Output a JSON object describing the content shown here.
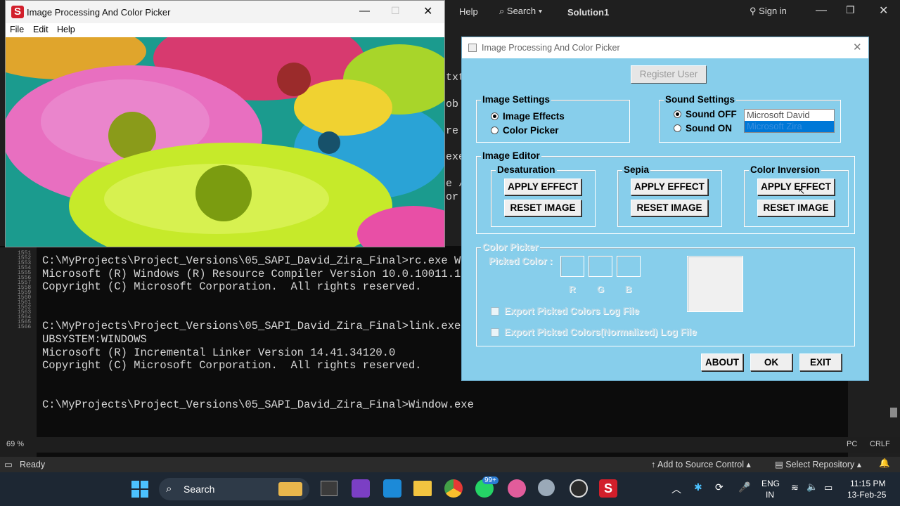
{
  "vs": {
    "menu_help": "Help",
    "search_label": "Search",
    "solution_name": "Solution1",
    "sign_in": "Sign in",
    "side_text": [
      "txt",
      "ob",
      "re",
      "exe",
      "e /",
      "or"
    ],
    "gutter_lines": [
      "1551",
      "1552",
      "1553",
      "1554",
      "1555",
      "1556",
      "1557",
      "1558",
      "1559",
      "1560",
      "1561",
      "1562",
      "1563",
      "1564",
      "1565",
      "1566"
    ],
    "console_lines": [
      "C:\\MyProjects\\Project_Versions\\05_SAPI_David_Zira_Final>rc.exe W",
      "Microsoft (R) Windows (R) Resource Compiler Version 10.0.10011.1",
      "Copyright (C) Microsoft Corporation.  All rights reserved.",
      "",
      "",
      "C:\\MyProjects\\Project_Versions\\05_SAPI_David_Zira_Final>link.exe",
      "UBSYSTEM:WINDOWS",
      "Microsoft (R) Incremental Linker Version 14.41.34120.0",
      "Copyright (C) Microsoft Corporation.  All rights reserved.",
      "",
      "",
      "C:\\MyProjects\\Project_Versions\\05_SAPI_David_Zira_Final>Window.exe"
    ],
    "zoom": "69 %",
    "line_ending": "CRLF",
    "encoding_partial": "PC",
    "status_ready": "Ready",
    "add_source_control": "Add to Source Control",
    "select_repository": "Select Repository"
  },
  "win1": {
    "title": "Image Processing And Color Picker",
    "menu": [
      "File",
      "Edit",
      "Help"
    ]
  },
  "dialog": {
    "title": "Image Processing And Color Picker",
    "register_user": "Register User",
    "image_settings": {
      "label": "Image Settings",
      "options": [
        "Image Effects",
        "Color Picker"
      ],
      "selected": 0
    },
    "sound_settings": {
      "label": "Sound Settings",
      "options": [
        "Sound OFF",
        "Sound ON"
      ],
      "selected": 0,
      "voices": [
        "Microsoft David",
        "Microsoft Zira"
      ],
      "selected_voice": 1
    },
    "image_editor": {
      "label": "Image Editor",
      "groups": [
        {
          "label": "Desaturation",
          "apply": "APPLY EFFECT",
          "reset": "RESET IMAGE"
        },
        {
          "label": "Sepia",
          "apply": "APPLY EFFECT",
          "reset": "RESET IMAGE"
        },
        {
          "label": "Color Inversion",
          "apply": "APPLY EFFECT",
          "reset": "RESET IMAGE"
        }
      ]
    },
    "color_picker": {
      "label": "Color Picker",
      "picked_color": "Picked Color :",
      "channels": [
        "R",
        "G",
        "B"
      ],
      "export_log": "Export Picked Colors Log File",
      "export_norm_log": "Export Picked Colors(Normalized) Log File"
    },
    "buttons": {
      "about": "ABOUT",
      "ok": "OK",
      "exit": "EXIT"
    }
  },
  "taskbar": {
    "search": "Search",
    "lang": "ENG",
    "region": "IN",
    "time": "11:15 PM",
    "date": "13-Feb-25",
    "badge": "99+"
  },
  "colors": {
    "dialog_bg": "#87ceeb",
    "accent": "#0078d7",
    "taskbar_bg": "#1d2733"
  }
}
